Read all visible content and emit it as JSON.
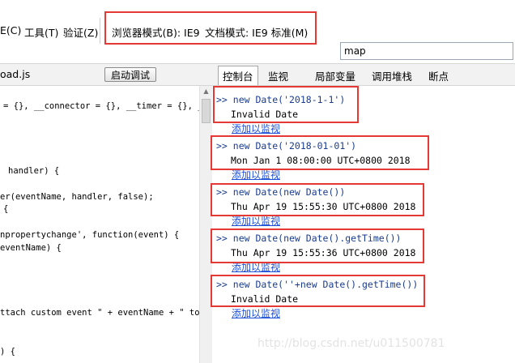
{
  "menu": {
    "items": [
      "E(C)",
      "工具(T)",
      "验证(Z)"
    ],
    "browser_mode": "浏览器模式(B): IE9",
    "document_mode": "文档模式: IE9 标准(M)"
  },
  "search": {
    "value": "map"
  },
  "toolbar": {
    "file_name": "oad.js",
    "debug_button": "启动调试",
    "tabs": [
      "控制台",
      "监视",
      "局部变量",
      "调用堆栈",
      "断点"
    ]
  },
  "code_lines": [
    "= {}, __connector = {}, __timer = {}, __",
    "handler) {",
    "er(eventName, handler, false);",
    "{",
    "npropertychange', function(event) {",
    "eventName) {",
    "ttach custom event \" + eventName + \" to s",
    ") {"
  ],
  "console": {
    "entries": [
      {
        "command": ">> new Date('2018-1-1')",
        "output": "Invalid Date",
        "watch": "添加以监视"
      },
      {
        "command": ">> new Date('2018-01-01')",
        "output": "Mon Jan 1 08:00:00 UTC+0800 2018",
        "watch": "添加以监视"
      },
      {
        "command": ">> new Date(new Date())",
        "output": "Thu Apr 19 15:55:30 UTC+0800 2018",
        "watch": "添加以监视"
      },
      {
        "command": ">> new Date(new Date().getTime())",
        "output": "Thu Apr 19 15:55:36 UTC+0800 2018",
        "watch": "添加以监视"
      },
      {
        "command": ">> new Date(''+new Date().getTime())",
        "output": "Invalid Date",
        "watch": "添加以监视"
      }
    ]
  },
  "watermark": "http://blog.csdn.net/u011500781",
  "colors": {
    "highlight_border": "#e53935",
    "link": "#1d4fd8",
    "command": "#1a3d8f"
  }
}
